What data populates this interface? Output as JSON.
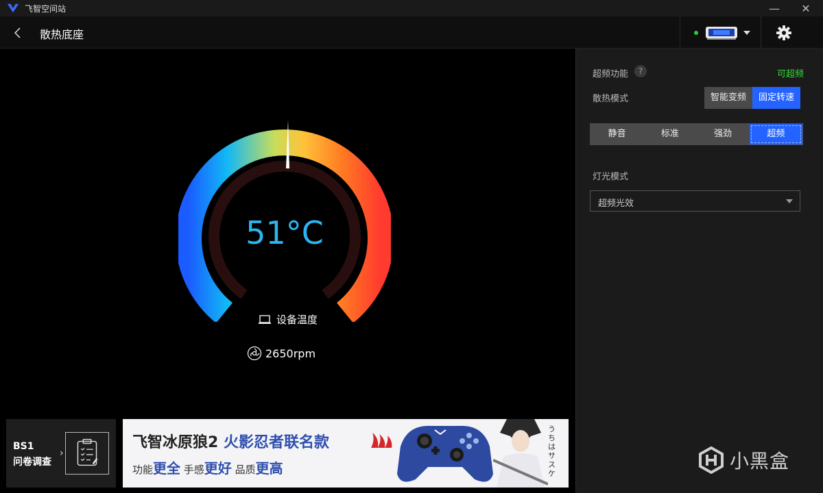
{
  "window": {
    "app_title": "飞智空间站",
    "minimize_glyph": "—",
    "close_glyph": "✕"
  },
  "header": {
    "page_title": "散热底座",
    "device_status_color": "#24d13a"
  },
  "gauge": {
    "temperature": "51°C",
    "device_temp_label": "设备温度",
    "fan_speed": "2650rpm",
    "accent": "#2bb6f0"
  },
  "panel": {
    "overclock_label": "超频功能",
    "help_glyph": "?",
    "overclock_status": "可超频",
    "cooling_mode_label": "散热模式",
    "cooling_modes": [
      {
        "label": "智能变频",
        "active": false
      },
      {
        "label": "固定转速",
        "active": true
      }
    ],
    "speed_presets": [
      {
        "label": "静音",
        "active": false
      },
      {
        "label": "标准",
        "active": false
      },
      {
        "label": "强劲",
        "active": false
      },
      {
        "label": "超频",
        "active": true
      }
    ],
    "light_mode_label": "灯光模式",
    "light_mode_value": "超频光效"
  },
  "survey": {
    "line1": "BS1",
    "line2": "问卷调查",
    "chevron": "›"
  },
  "banner": {
    "headline_black": "飞智冰原狼2 ",
    "headline_blue": "火影忍者联名款",
    "sub": [
      {
        "plain": "功能",
        "bold": "更全"
      },
      {
        "plain": "手感",
        "bold": "更好"
      },
      {
        "plain": "品质",
        "bold": "更高"
      }
    ],
    "vertical_text": "うちはサスケ"
  },
  "watermark": {
    "text": "小黑盒"
  }
}
